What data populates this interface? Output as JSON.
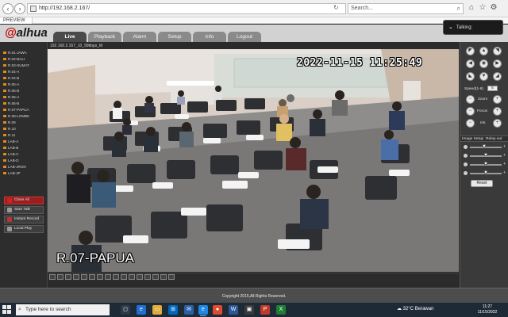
{
  "browser": {
    "url": "http://192.168.2.167/",
    "search_placeholder": "Search...",
    "tab_title": "PREVIEW"
  },
  "app": {
    "logo": "alhua",
    "nav_tabs": [
      "Live",
      "Playback",
      "Alarm",
      "Setup",
      "Info",
      "Logout"
    ],
    "active_tab": "Live",
    "talking_label": "Talking:"
  },
  "channels": [
    "R.01-JAWA",
    "R.02-BALI",
    "R.03-SUMAT",
    "R.04-A",
    "R.04-B",
    "R.05-A",
    "R.05-B",
    "R.06-A",
    "R.06-B",
    "R.07-PAPUA",
    "R.08-LOMBK",
    "R.09",
    "R.10",
    "R.11",
    "LAB-A",
    "LAB-B",
    "LAB-C",
    "LAB-D",
    "LAB-JRGN",
    "LAB-JP"
  ],
  "left_buttons": {
    "close_all": "Close All",
    "start_talk": "Start Talk",
    "instant_record": "Instant Record",
    "local_play": "Local Play"
  },
  "video": {
    "header": "192.168.2.167_10_99kbps_M",
    "timestamp": "2022-11-15  11:25:49",
    "camera_label": "R.07-PAPUA"
  },
  "ptz": {
    "speed_label": "Speed(1-8)",
    "speed_value": "5",
    "zoom_label": "Zoom",
    "focus_label": "Focus",
    "iris_label": "Iris"
  },
  "image_setup": {
    "label": "Image Setup",
    "relay_label": "Relay-out",
    "reset_label": "Reset",
    "levels": [
      0.45,
      0.5,
      0.5,
      0.5
    ]
  },
  "footer": {
    "copyright": "Copyright 2015,All Rights Reserved."
  },
  "taskbar": {
    "search_placeholder": "Type here to search",
    "weather": "32°C  Berawan",
    "time": "11:27",
    "date": "11/15/2022"
  }
}
